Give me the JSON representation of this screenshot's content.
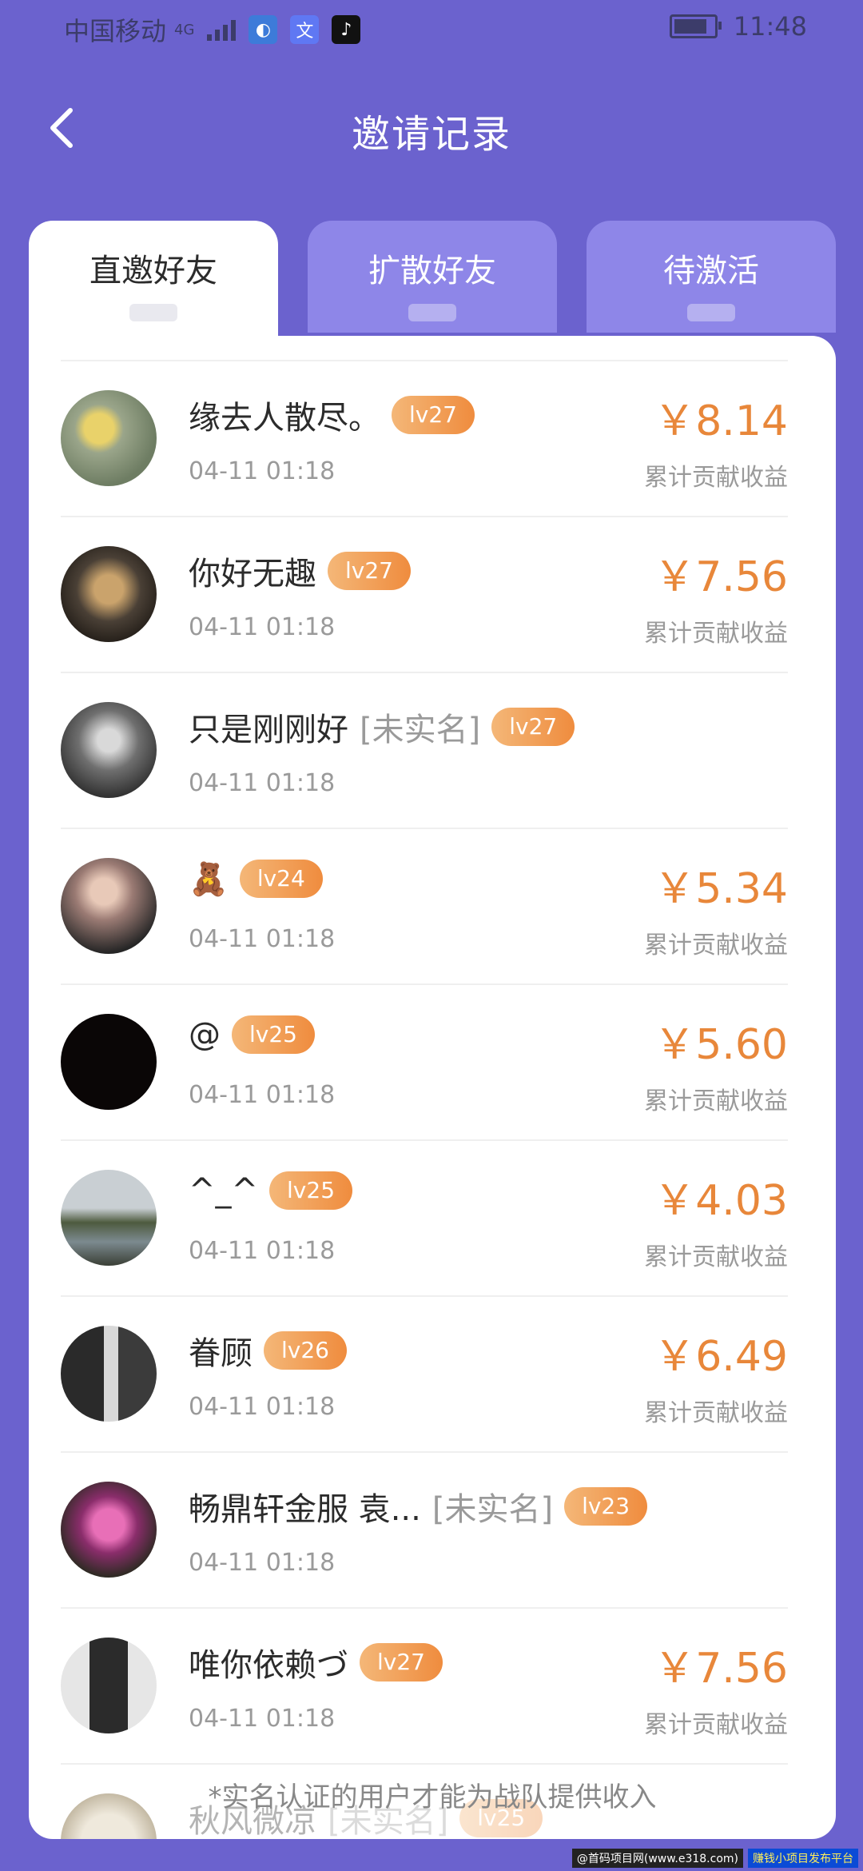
{
  "status": {
    "carrier": "中国移动",
    "network": "4G",
    "time": "11:48"
  },
  "nav": {
    "title": "邀请记录"
  },
  "tabs": [
    {
      "label": "直邀好友",
      "active": true
    },
    {
      "label": "扩散好友",
      "active": false
    },
    {
      "label": "待激活",
      "active": false
    }
  ],
  "currency_symbol": "￥",
  "amount_caption": "累计贡献收益",
  "unverified_tag": "[未实名]",
  "items": [
    {
      "name": "缘去人散尽。",
      "level": "lv27",
      "time": "04-11 01:18",
      "amount": "￥8.14",
      "amount_label": "累计贡献收益"
    },
    {
      "name": "你好无趣",
      "level": "lv27",
      "time": "04-11 01:18",
      "amount": "￥7.56",
      "amount_label": "累计贡献收益"
    },
    {
      "name": "只是刚刚好",
      "tag": "[未实名]",
      "level": "lv27",
      "time": "04-11 01:18"
    },
    {
      "name": "🧸",
      "level": "lv24",
      "time": "04-11 01:18",
      "amount": "￥5.34",
      "amount_label": "累计贡献收益"
    },
    {
      "name": "@",
      "level": "lv25",
      "time": "04-11 01:18",
      "amount": "￥5.60",
      "amount_label": "累计贡献收益"
    },
    {
      "name": "^_^",
      "level": "lv25",
      "time": "04-11 01:18",
      "amount": "￥4.03",
      "amount_label": "累计贡献收益"
    },
    {
      "name": "眷顾",
      "level": "lv26",
      "time": "04-11 01:18",
      "amount": "￥6.49",
      "amount_label": "累计贡献收益"
    },
    {
      "name": "畅鼎轩金服 袁...",
      "tag": "[未实名]",
      "level": "lv23",
      "time": "04-11 01:18"
    },
    {
      "name": "唯你依赖づ",
      "level": "lv27",
      "time": "04-11 01:18",
      "amount": "￥7.56",
      "amount_label": "累计贡献收益"
    },
    {
      "name": "秋风微凉",
      "tag": "[未实名]",
      "level": "lv25"
    }
  ],
  "footnote": "*实名认证的用户才能为战队提供收入",
  "watermark": [
    "@首码项目网(www.e318.com)",
    "赚钱小项目发布平台"
  ],
  "colors": {
    "background": "#6B62CE",
    "accent": "#E8873A"
  }
}
